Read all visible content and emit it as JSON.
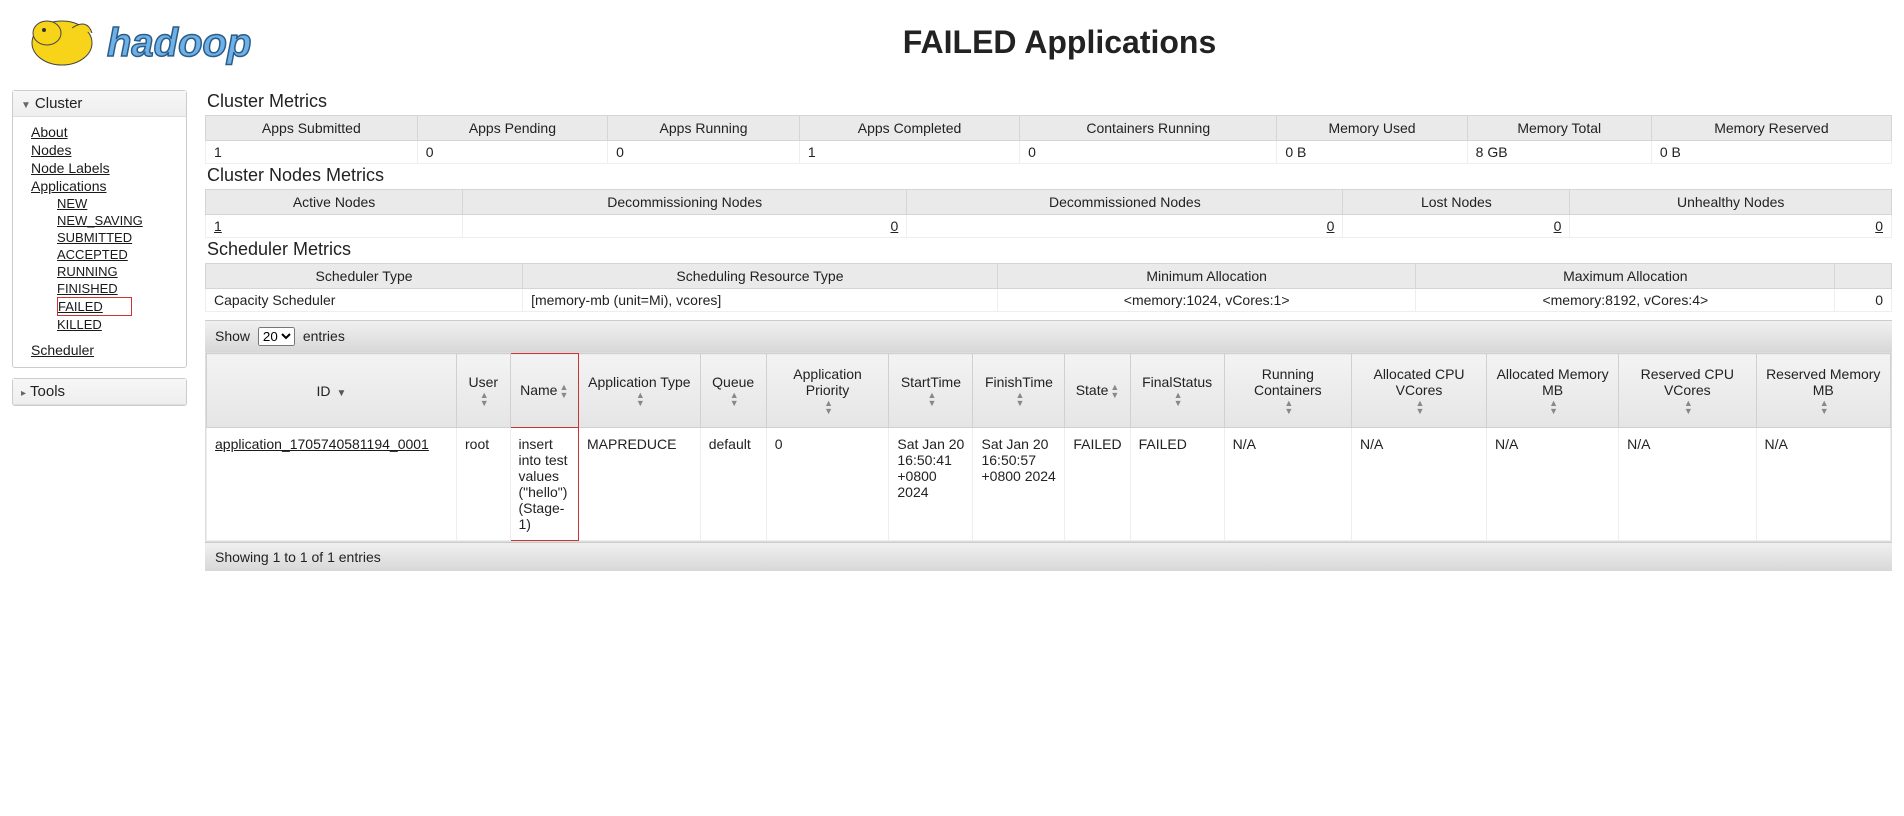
{
  "title": "FAILED Applications",
  "sidebar": {
    "cluster_label": "Cluster",
    "tools_label": "Tools",
    "links": {
      "about": "About",
      "nodes": "Nodes",
      "node_labels": "Node Labels",
      "applications": "Applications",
      "scheduler": "Scheduler"
    },
    "app_states": {
      "new": "NEW",
      "new_saving": "NEW_SAVING",
      "submitted": "SUBMITTED",
      "accepted": "ACCEPTED",
      "running": "RUNNING",
      "finished": "FINISHED",
      "failed": "FAILED",
      "killed": "KILLED"
    }
  },
  "cluster_metrics": {
    "heading": "Cluster Metrics",
    "headers": [
      "Apps Submitted",
      "Apps Pending",
      "Apps Running",
      "Apps Completed",
      "Containers Running",
      "Memory Used",
      "Memory Total",
      "Memory Reserved"
    ],
    "values": [
      "1",
      "0",
      "0",
      "1",
      "0",
      "0 B",
      "8 GB",
      "0 B"
    ]
  },
  "nodes_metrics": {
    "heading": "Cluster Nodes Metrics",
    "headers": [
      "Active Nodes",
      "Decommissioning Nodes",
      "Decommissioned Nodes",
      "Lost Nodes",
      "Unhealthy Nodes"
    ],
    "values": [
      "1",
      "0",
      "0",
      "0",
      "0"
    ]
  },
  "scheduler_metrics": {
    "heading": "Scheduler Metrics",
    "headers": [
      "Scheduler Type",
      "Scheduling Resource Type",
      "Minimum Allocation",
      "Maximum Allocation"
    ],
    "values": [
      "Capacity Scheduler",
      "[memory-mb (unit=Mi), vcores]",
      "<memory:1024, vCores:1>",
      "<memory:8192, vCores:4>"
    ],
    "trailing": "0"
  },
  "table": {
    "show_label": "Show",
    "entries_label": "entries",
    "page_size": "20",
    "columns": [
      "ID",
      "User",
      "Name",
      "Application Type",
      "Queue",
      "Application Priority",
      "StartTime",
      "FinishTime",
      "State",
      "FinalStatus",
      "Running Containers",
      "Allocated CPU VCores",
      "Allocated Memory MB",
      "Reserved CPU VCores",
      "Reserved Memory MB"
    ],
    "row": {
      "id": "application_1705740581194_0001",
      "user": "root",
      "name": "insert into test values (\"hello\")(Stage-1)",
      "type": "MAPREDUCE",
      "queue": "default",
      "priority": "0",
      "start": "Sat Jan 20 16:50:41 +0800 2024",
      "finish": "Sat Jan 20 16:50:57 +0800 2024",
      "state": "FAILED",
      "fstatus": "FAILED",
      "running": "N/A",
      "acpu": "N/A",
      "amem": "N/A",
      "rcpu": "N/A",
      "rmem": "N/A"
    },
    "footer": "Showing 1 to 1 of 1 entries"
  }
}
